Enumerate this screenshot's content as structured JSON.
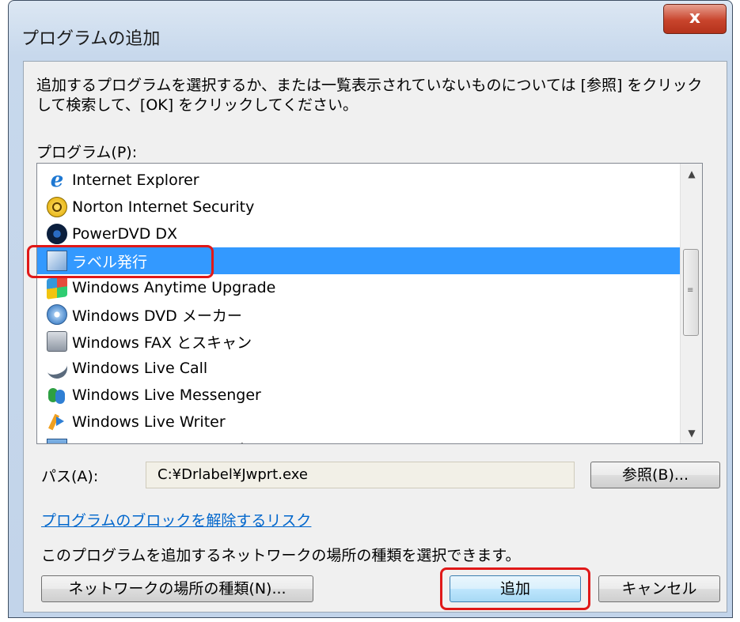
{
  "window": {
    "title": "プログラムの追加",
    "close_label": "x"
  },
  "dialog": {
    "instruction": "追加するプログラムを選択するか、または一覧表示されていないものについては [参照] をクリックして検索して、[OK] をクリックしてください。",
    "programs_label": "プログラム(P):",
    "programs": [
      {
        "name": "Internet Explorer",
        "icon": "internet-explorer-icon"
      },
      {
        "name": "Norton Internet Security",
        "icon": "norton-icon"
      },
      {
        "name": "PowerDVD DX",
        "icon": "powerdvd-icon"
      },
      {
        "name": "ラベル発行",
        "icon": "label-app-icon",
        "selected": true
      },
      {
        "name": "Windows Anytime Upgrade",
        "icon": "windows-flag-icon"
      },
      {
        "name": "Windows DVD メーカー",
        "icon": "dvd-maker-icon"
      },
      {
        "name": "Windows FAX とスキャン",
        "icon": "fax-icon"
      },
      {
        "name": "Windows Live Call",
        "icon": "phone-icon"
      },
      {
        "name": "Windows Live Messenger",
        "icon": "messenger-icon"
      },
      {
        "name": "Windows Live Writer",
        "icon": "writer-icon"
      },
      {
        "name": "Windows Live フォト ギャラリー",
        "icon": "gallery-icon"
      }
    ],
    "path_label": "パス(A):",
    "path_value": "C:¥Drlabel¥Jwprt.exe",
    "browse_label": "参照(B)...",
    "unblock_link": "プログラムのブロックを解除するリスク",
    "network_info": "このプログラムを追加するネットワークの場所の種類を選択できます。",
    "network_button": "ネットワークの場所の種類(N)...",
    "add_button": "追加",
    "cancel_button": "キャンセル"
  },
  "colors": {
    "selection": "#3399ff",
    "highlight": "#e01818",
    "link": "#0066cc"
  }
}
